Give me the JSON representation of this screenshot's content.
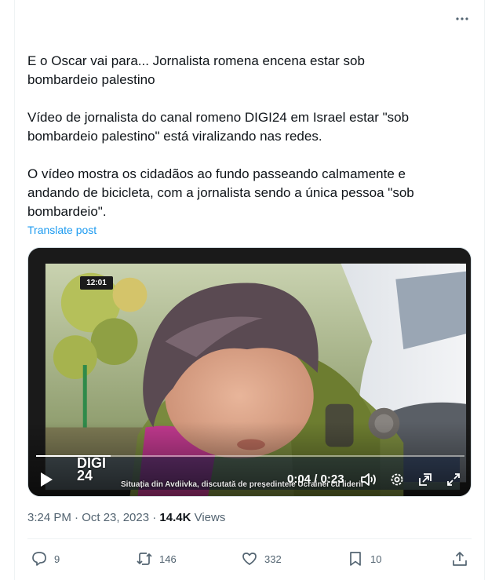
{
  "tweet": {
    "paragraphs": [
      "E o Oscar vai para... Jornalista romena encena estar sob bombardeio palestino",
      "Vídeo de jornalista do canal romeno DIGI24 em Israel estar \"sob bombardeio palestino\" está viralizando nas redes.",
      "O vídeo mostra os cidadãos ao fundo passeando calmamente e andando de bicicleta, com a jornalista sendo a única pessoa \"sob bombardeio\"."
    ],
    "translate_label": "Translate post",
    "timestamp": "3:24 PM · Oct 23, 2023 · ",
    "views_count": "14.4K",
    "views_label": " Views"
  },
  "video": {
    "clock_badge": "12:01",
    "channel_logo_line1": "DIGI",
    "channel_logo_line2": "24",
    "ticker_text": "Situația din Avdiivka, discutată de președintele Ucrainei cu liderii",
    "time_display": "0:04 / 0:23",
    "progress_fraction": 0.174
  },
  "actions": {
    "reply_count": "9",
    "retweet_count": "146",
    "like_count": "332",
    "bookmark_count": "10"
  },
  "icons": {
    "more": "more-horizontal-icon",
    "play": "play-icon",
    "volume": "volume-icon",
    "settings": "gear-icon",
    "pip": "picture-in-picture-icon",
    "fullscreen": "fullscreen-icon",
    "reply": "reply-icon",
    "retweet": "retweet-icon",
    "like": "heart-icon",
    "bookmark": "bookmark-icon",
    "share": "share-icon"
  },
  "colors": {
    "text": "#0f1419",
    "secondary": "#536471",
    "link": "#1d9bf0",
    "border": "#eff3f4"
  }
}
